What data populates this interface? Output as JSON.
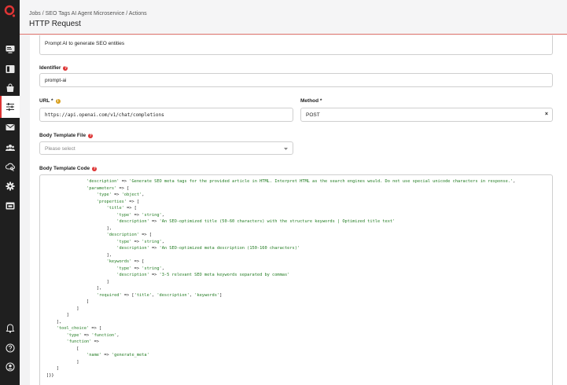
{
  "colors": {
    "accent": "#d33333",
    "sidebar": "#1f1f1f",
    "string": "#1f7a1f"
  },
  "sidebar": {
    "icons": [
      "logo",
      "monitor-icon",
      "sidebar-panel-icon",
      "bag-icon",
      "sliders-icon",
      "mail-icon",
      "users-icon",
      "cloud-search-icon",
      "gear-icon",
      "card-icon",
      "bell-icon",
      "help-icon",
      "user-circle-icon"
    ]
  },
  "header": {
    "breadcrumb": "Jobs / SEO Tags AI Agent Microservice / Actions",
    "title": "HTTP Request"
  },
  "form": {
    "description_value": "Prompt AI to generate SEO entities",
    "identifier_label": "Identifier",
    "identifier_value": "prompt-ai",
    "url_label": "URL *",
    "url_value": "https://api.openai.com/v1/chat/completions",
    "method_label": "Method *",
    "method_value": "POST",
    "method_clear": "×",
    "body_file_label": "Body Template File",
    "body_file_placeholder": "Please select",
    "body_code_label": "Body Template Code",
    "req_glyph": "?",
    "info_glyph": "i"
  },
  "code_lines": [
    "                'description' => 'Generate SEO meta tags for the provided article in HTML. Interpret HTML as the search engines would. Do not use special unicode characters in response.',",
    "                'parameters' => [",
    "                    'type' => 'object',",
    "                    'properties' => [",
    "                        'title' => [",
    "                            'type' => 'string',",
    "                            'description' => 'An SEO-optimized title (50-60 characters) with the structure keywords | Optimized title text'",
    "                        ],",
    "                        'description' => [",
    "                            'type' => 'string',",
    "                            'description' => 'An SEO-optimized meta description (150-160 characters)'",
    "                        ],",
    "                        'keywords' => [",
    "                            'type' => 'string',",
    "                            'description' => '3-5 relevant SEO meta keywords separated by commas'",
    "                        ]",
    "                    ],",
    "                    'required' => ['title', 'description', 'keywords']",
    "                ]",
    "            ]",
    "        ]",
    "    ],",
    "    'tool_choice' => [",
    "        'type' => 'function',",
    "        'function' =>",
    "            [",
    "                'name' => 'generate_meta'",
    "            ]",
    "    ]",
    "]}}"
  ]
}
